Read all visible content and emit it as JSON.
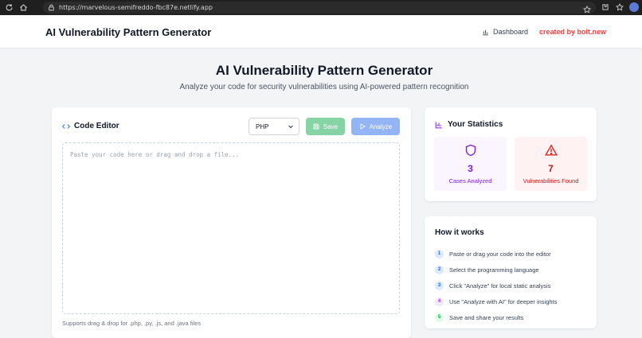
{
  "browser": {
    "url": "https://marvelous-semifreddo-fbc87e.netlify.app"
  },
  "header": {
    "title": "AI Vulnerability Pattern Generator",
    "dashboard_label": "Dashboard",
    "bolt_label": "created by bolt.new"
  },
  "hero": {
    "title": "AI Vulnerability Pattern Generator",
    "subtitle": "Analyze your code for security vulnerabilities using AI-powered pattern recognition"
  },
  "editor": {
    "heading": "Code Editor",
    "language": "PHP",
    "save_label": "Save",
    "analyze_label": "Analyze",
    "placeholder": "Paste your code here or drag and drop a file...",
    "hint": "Supports drag & drop for .php, .py, .js, and .java files"
  },
  "stats": {
    "heading": "Your Statistics",
    "cases_value": "3",
    "cases_label": "Cases Analyzed",
    "vulns_value": "7",
    "vulns_label": "Vulnerabilities Found"
  },
  "how": {
    "heading": "How it works",
    "steps": [
      {
        "num": "1",
        "text": "Paste or drag your code into the editor"
      },
      {
        "num": "2",
        "text": "Select the programming language"
      },
      {
        "num": "3",
        "text": "Click \"Analyze\" for local static analysis"
      },
      {
        "num": "4",
        "text": "Use \"Analyze with AI\" for deeper insights"
      },
      {
        "num": "5",
        "text": "Save and share your results"
      }
    ]
  },
  "colors": {
    "accent_blue": "#3b82f6",
    "accent_purple": "#9333ea",
    "danger_red": "#dc2626",
    "save_green": "#86d4a6",
    "bolt_red": "#ef4444"
  }
}
